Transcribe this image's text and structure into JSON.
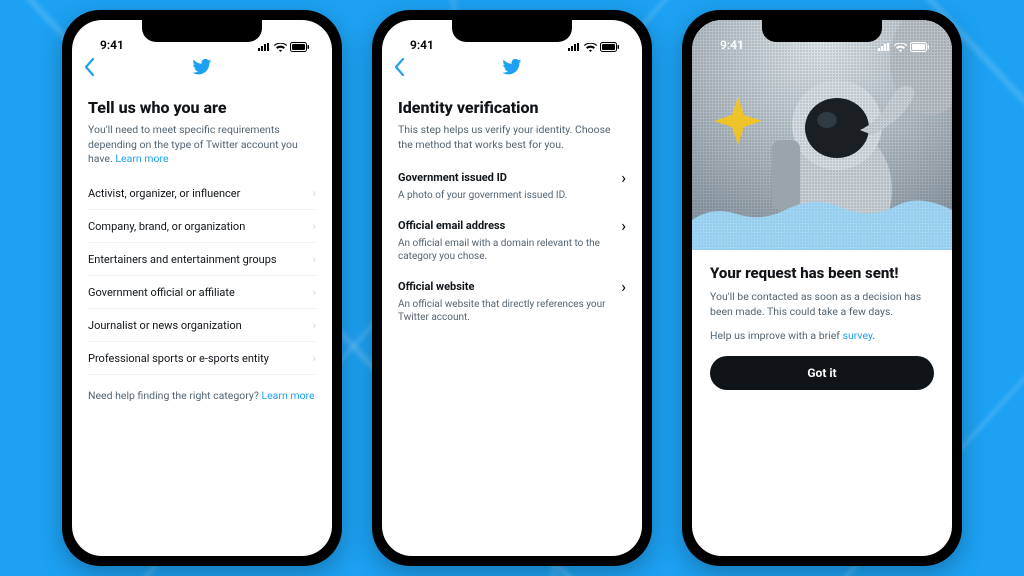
{
  "status": {
    "time": "9:41"
  },
  "phone1": {
    "title": "Tell us who you are",
    "subtitle": "You'll need to meet specific requirements depending on the type of Twitter account you have. ",
    "learn_more": "Learn more",
    "categories": [
      "Activist, organizer, or influencer",
      "Company, brand, or organization",
      "Entertainers and entertainment groups",
      "Government official or affiliate",
      "Journalist or news organization",
      "Professional sports or e-sports entity"
    ],
    "help_text": "Need help finding the right category? ",
    "help_link": "Learn more"
  },
  "phone2": {
    "title": "Identity verification",
    "subtitle": "This step helps us verify your identity. Choose the method that works best for you.",
    "options": [
      {
        "label": "Government issued ID",
        "desc": "A photo of your government issued ID."
      },
      {
        "label": "Official email address",
        "desc": "An official email with a domain relevant to the category you chose."
      },
      {
        "label": "Official website",
        "desc": "An official website that directly references your Twitter account."
      }
    ]
  },
  "phone3": {
    "title": "Your request has been sent!",
    "body": "You'll be contacted as soon as a decision has been made. This could take a few days.",
    "survey_text": "Help us improve with a brief ",
    "survey_link": "survey",
    "survey_period": ".",
    "button": "Got it"
  }
}
